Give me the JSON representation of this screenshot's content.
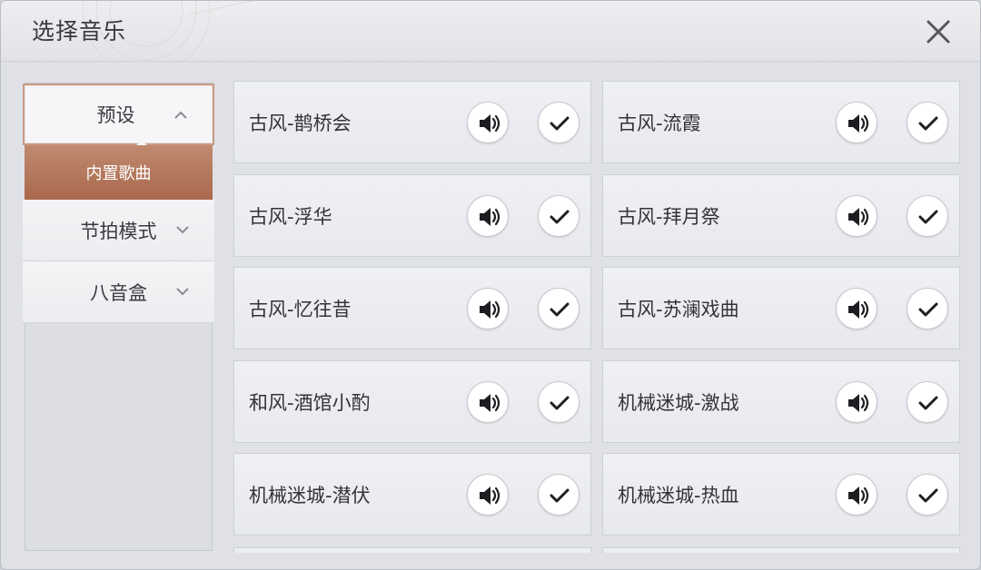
{
  "header": {
    "title": "选择音乐"
  },
  "sidebar": {
    "items": [
      {
        "label": "预设",
        "expanded": true,
        "chevron": "chevron-up-icon"
      },
      {
        "label": "节拍模式",
        "expanded": false,
        "chevron": "chevron-down-icon"
      },
      {
        "label": "八音盒",
        "expanded": false,
        "chevron": "chevron-down-icon"
      }
    ],
    "sub_items": [
      {
        "label": "内置歌曲",
        "selected": true
      }
    ]
  },
  "songs": [
    "古风-鹊桥会",
    "古风-流霞",
    "古风-浮华",
    "古风-拜月祭",
    "古风-忆往昔",
    "古风-苏澜戏曲",
    "和风-酒馆小酌",
    "机械迷城-激战",
    "机械迷城-潜伏",
    "机械迷城-热血"
  ],
  "icons": {
    "preview": "speaker-icon",
    "select": "checkmark-icon",
    "close": "close-icon"
  },
  "colors": {
    "accent": "#b47659",
    "accent_border": "#c89a86"
  }
}
